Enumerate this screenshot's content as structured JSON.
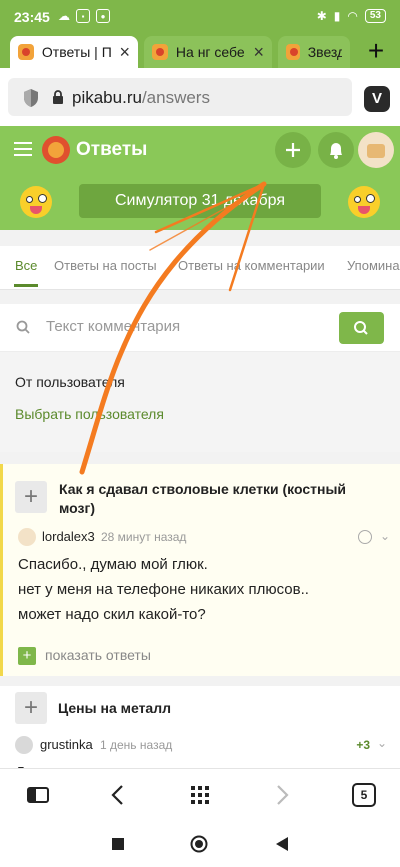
{
  "status": {
    "time": "23:45",
    "battery": "53"
  },
  "browser": {
    "tabs": [
      {
        "label": "Ответы | Пикабу"
      },
      {
        "label": "На нг себе"
      },
      {
        "label": "Звезд"
      }
    ],
    "url_domain": "pikabu.ru",
    "url_path": "/answers",
    "tab_count": "5"
  },
  "header": {
    "title": "Ответы",
    "simulator_label": "Симулятор 31 декабря"
  },
  "subnav": {
    "items": [
      "Все",
      "Ответы на посты",
      "Ответы на комментарии",
      "Упомина"
    ]
  },
  "search": {
    "placeholder": "Текст комментария"
  },
  "user_filter": {
    "label": "От пользователя",
    "link": "Выбрать пользователя"
  },
  "comments": [
    {
      "post_title": "Как я сдавал стволовые клетки (костный мозг)",
      "user": "lordalex3",
      "time": "28 минут назад",
      "lines": [
        "Спасибо., думаю мой глюк.",
        "нет у меня на телефоне никаких плюсов..",
        "может надо скил какой-то?"
      ],
      "show_replies": "показать ответы"
    },
    {
      "post_title": "Цены на металл",
      "user": "grustinka",
      "time": "1 день назад",
      "score": "+3",
      "lines": [
        "До прихода сюда осеурещие мора"
      ]
    }
  ],
  "colors": {
    "accent": "#8ac858",
    "link": "#5b8a2c",
    "annotation": "#f47b20"
  }
}
